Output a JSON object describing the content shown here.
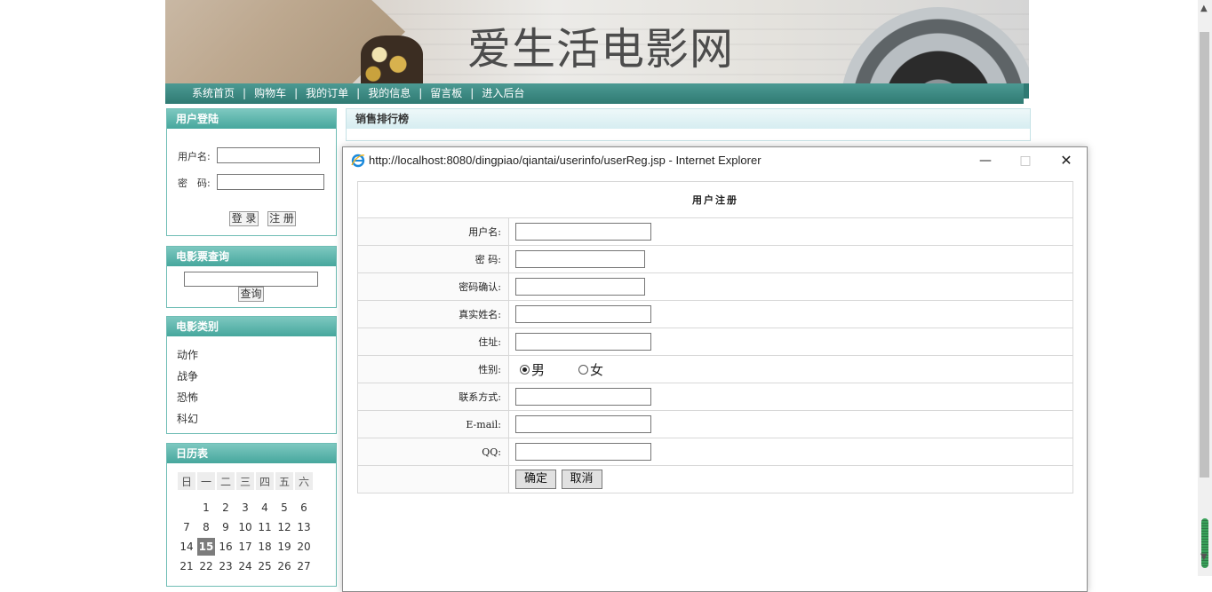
{
  "banner": {
    "title": "爱生活电影网"
  },
  "nav": {
    "items": [
      "系统首页",
      "购物车",
      "我的订单",
      "我的信息",
      "留言板",
      "进入后台"
    ],
    "separator": "|"
  },
  "login": {
    "header": "用户登陆",
    "username_label": "用户名:",
    "password_label": "密　码:",
    "login_button": "登 录",
    "register_button": "注 册"
  },
  "ticket_search": {
    "header": "电影票查询",
    "search_button": "查询"
  },
  "categories": {
    "header": "电影类别",
    "items": [
      "动作",
      "战争",
      "恐怖",
      "科幻"
    ]
  },
  "calendar": {
    "header": "日历表",
    "weekdays": [
      "日",
      "一",
      "二",
      "三",
      "四",
      "五",
      "六"
    ],
    "rows": [
      [
        "",
        "1",
        "2",
        "3",
        "4",
        "5",
        "6"
      ],
      [
        "7",
        "8",
        "9",
        "10",
        "11",
        "12",
        "13"
      ],
      [
        "14",
        "15",
        "16",
        "17",
        "18",
        "19",
        "20"
      ],
      [
        "21",
        "22",
        "23",
        "24",
        "25",
        "26",
        "27"
      ]
    ],
    "today": "15"
  },
  "sales": {
    "header": "销售排行榜"
  },
  "popup": {
    "window_title": "http://localhost:8080/dingpiao/qiantai/userinfo/userReg.jsp - Internet Explorer",
    "form_title": "用户注册",
    "fields": {
      "username": "用户名:",
      "password": "密 码:",
      "password_confirm": "密码确认:",
      "real_name": "真实姓名:",
      "address": "住址:",
      "gender": "性别:",
      "contact": "联系方式:",
      "email": "E-mail:",
      "qq": "QQ:"
    },
    "gender_options": [
      "男",
      "女"
    ],
    "gender_selected": "男",
    "confirm_button": "确定",
    "cancel_button": "取消"
  },
  "colors": {
    "nav_bg": "#2f7a73",
    "side_header": "#46a79d",
    "side_border": "#6fbdb5"
  }
}
